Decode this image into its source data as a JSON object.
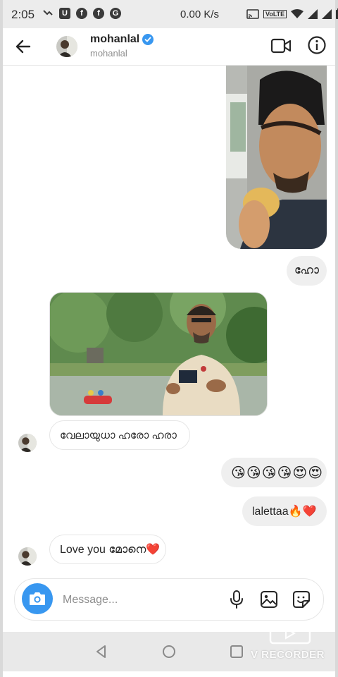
{
  "status_bar": {
    "time": "2:05",
    "net_speed": "0.00 K/s",
    "volte_label": "VoLTE",
    "icons": [
      "missed-call-icon",
      "u-app-icon",
      "facebook-icon",
      "facebook-icon",
      "google-icon",
      "cast-icon",
      "wifi-icon",
      "signal-icon",
      "signal-icon",
      "battery-icon"
    ]
  },
  "header": {
    "username": "mohanlal",
    "handle": "mohanlal",
    "verified_color": "#3897f0"
  },
  "messages": {
    "ho": "ഹോ",
    "velayudha": "വേലായുധാ ഹരോ ഹരാ",
    "emoji_row": "😘😘😘😘😍😍",
    "laletta": "lalettaa🔥❤️",
    "love_you": "Love you മോനെ❤️"
  },
  "composer": {
    "placeholder": "Message...",
    "accent_color": "#3897f0"
  },
  "watermark": {
    "text": "V RECORDER"
  }
}
